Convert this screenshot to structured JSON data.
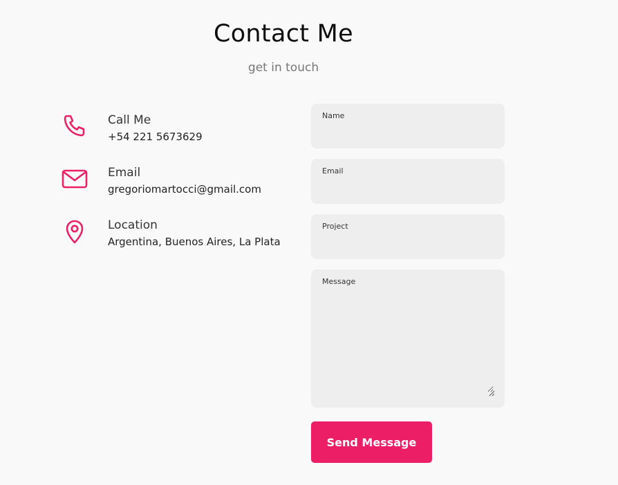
{
  "header": {
    "title": "Contact Me",
    "subtitle": "get in touch"
  },
  "contact_info": [
    {
      "icon": "phone-icon",
      "label": "Call Me",
      "value": "+54 221 5673629"
    },
    {
      "icon": "mail-icon",
      "label": "Email",
      "value": "gregoriomartocci@gmail.com"
    },
    {
      "icon": "location-pin-icon",
      "label": "Location",
      "value": "Argentina, Buenos Aires, La Plata"
    }
  ],
  "form": {
    "name": {
      "label": "Name",
      "value": ""
    },
    "email": {
      "label": "Email",
      "value": ""
    },
    "project": {
      "label": "Project",
      "value": ""
    },
    "message": {
      "label": "Message",
      "value": ""
    },
    "submit_label": "Send Message"
  },
  "colors": {
    "accent": "#ec1f66",
    "background": "#f9f9f9",
    "field_background": "#eeeeee"
  }
}
